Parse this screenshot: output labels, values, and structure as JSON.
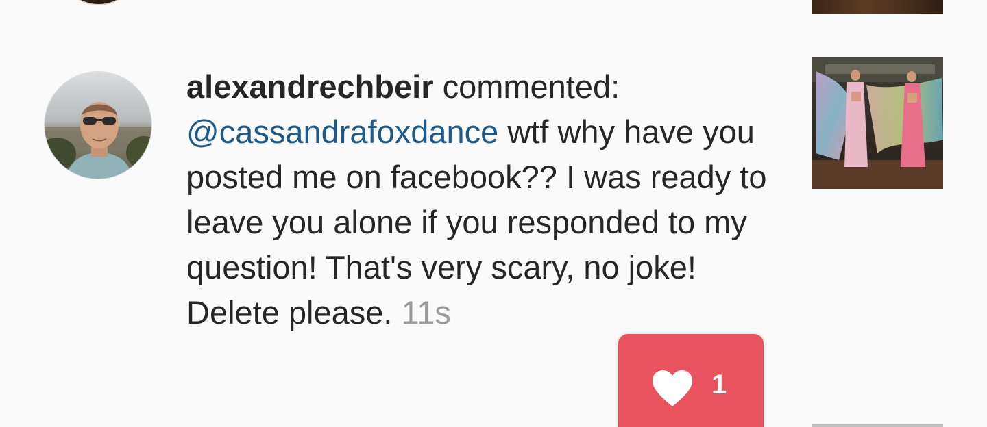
{
  "notification": {
    "username": "alexandrechbeir",
    "action": " commented:",
    "mention": "@cassandrafoxdance",
    "message": " wtf why have you posted me on facebook?? I was ready to leave you alone if you responded to my question! That's very scary, no joke! Delete please.",
    "time": "11s"
  },
  "likes_toast": {
    "icon": "heart-icon",
    "count": "1",
    "color": "#e8535e"
  },
  "colors": {
    "background": "#fafafa",
    "text": "#262626",
    "mention": "#1c5a8c",
    "timestamp": "#9a9a9a"
  }
}
